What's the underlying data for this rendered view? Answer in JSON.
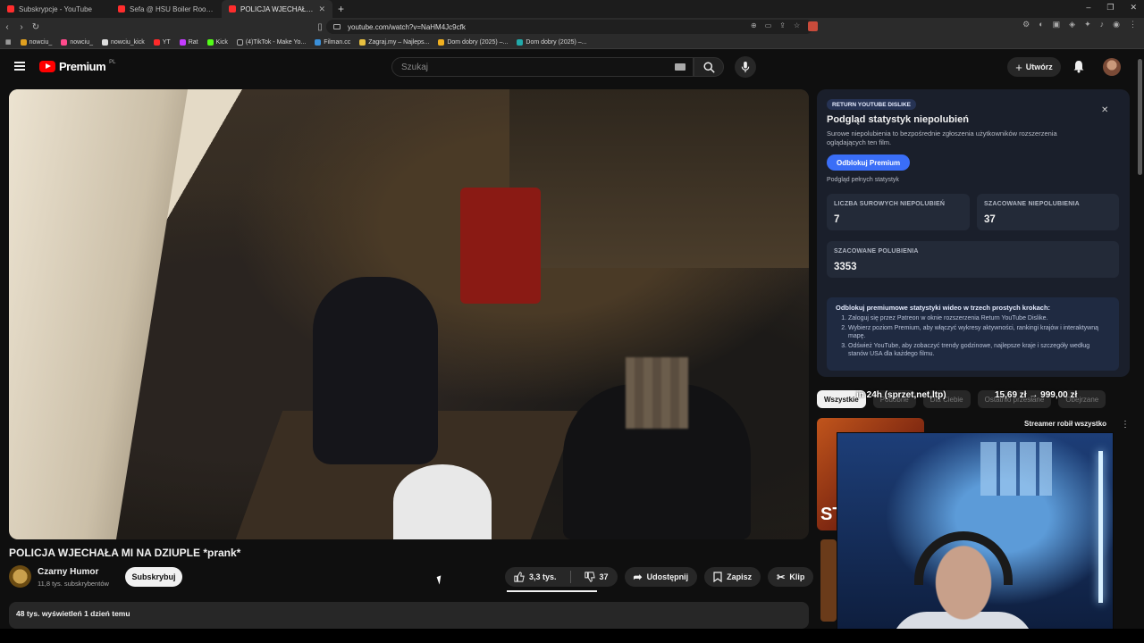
{
  "browser": {
    "tabs": [
      {
        "title": "Subskrypcje - YouTube",
        "active": false
      },
      {
        "title": "Sefa @ HSU Boiler Room Style Party",
        "active": false
      },
      {
        "title": "POLICJA WJECHAŁA MI NA DZIUPLE",
        "active": true
      }
    ],
    "url": "youtube.com/watch?v=NaHM4Jc9cfk",
    "bookmarks": [
      "nowciu_",
      "nowciu_kick",
      "YT",
      "Rat",
      "Kick",
      "(4)TikTok - Make Yo...",
      "Filman.cc",
      "Zagraj.my – Najleps...",
      "Dom dobry (2025) –...",
      "Dom dobry (2025) –..."
    ]
  },
  "header": {
    "logo_text": "Premium",
    "logo_country": "PL",
    "search_placeholder": "Szukaj",
    "create_label": "Utwórz"
  },
  "video": {
    "title": "POLICJA WJECHAŁA MI NA DZIUPLE *prank*",
    "channel_name": "Czarny Humor",
    "channel_subs": "11,8 tys. subskrybentów",
    "subscribe_label": "Subskrybuj",
    "likes": "3,3 tys.",
    "dislikes": "37",
    "share_label": "Udostępnij",
    "save_label": "Zapisz",
    "clip_label": "Klip",
    "views_date": "48 tys. wyświetleń  1 dzień temu"
  },
  "ryd": {
    "badge": "RETURN YOUTUBE DISLIKE",
    "title": "Podgląd statystyk niepolubień",
    "description": "Surowe niepolubienia to bezpośrednie zgłoszenia użytkowników rozszerzenia oglądających ten film.",
    "unlock_button": "Odblokuj Premium",
    "preview_text": "Podgląd pełnych statystyk",
    "stats": [
      {
        "label": "LICZBA SUROWYCH NIEPOLUBIEŃ",
        "value": "7"
      },
      {
        "label": "SZACOWANE NIEPOLUBIENIA",
        "value": "37"
      },
      {
        "label": "SZACOWANE POLUBIENIA",
        "value": "3353"
      }
    ],
    "steps_header": "Odblokuj premiumowe statystyki wideo w trzech prostych krokach:",
    "steps": [
      "Zaloguj się przez Patreon w oknie rozszerzenia Return YouTube Dislike.",
      "Wybierz poziom Premium, aby włączyć wykresy aktywności, rankingi krajów i interaktywną mapę.",
      "Odśwież YouTube, aby zobaczyć trendy godzinowe, najlepsze kraje i szczegóły według stanów USA dla każdego filmu."
    ]
  },
  "sidebar": {
    "chips": [
      "Wszystkie",
      "Podobne",
      "Dla Ciebie",
      "Ostatnio przesłane",
      "Obejrzane"
    ],
    "overlay_text": "in 24h (sprzet,net,ltp)",
    "overlay_price": "15,69 zł → 999,00 zł",
    "rec_title": "Streamer robił wszystko",
    "rec_thumb_text": "ST"
  }
}
